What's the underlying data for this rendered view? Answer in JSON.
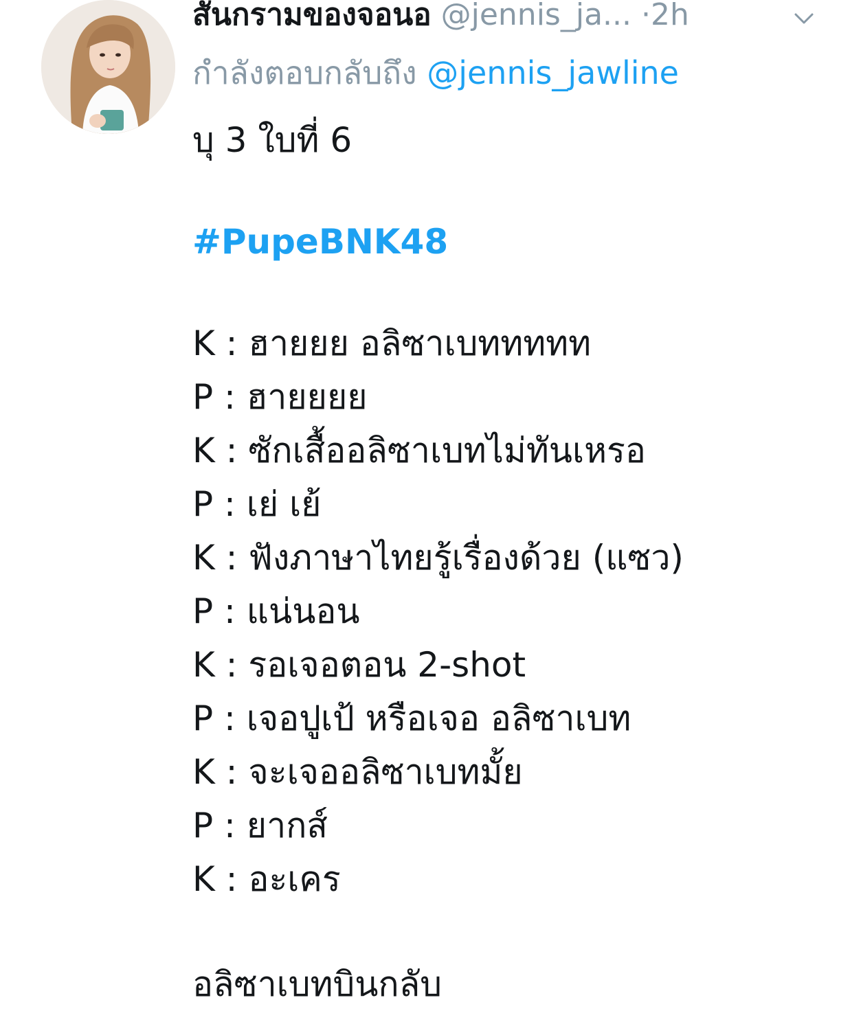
{
  "tweet": {
    "display_name": "สันกรามของจอนอ",
    "handle": "@jennis_ja...",
    "separator": "·",
    "time": "2h",
    "replying_prefix": "กำลังตอบกลับถึง",
    "replying_to": "@jennis_jawline",
    "intro": "บุ 3 ใบที่ 6",
    "hashtag": "#PupeBNK48",
    "dialogue": [
      "K : ฮายยย อลิซาเบททททท",
      "P : ฮายยยย",
      "K : ซักเสื้ออลิซาเบทไม่ทันเหรอ",
      "P : เย่ เย้",
      "K : ฟังภาษาไทยรู้เรื่องด้วย (แซว)",
      "P : แน่นอน",
      "K : รอเจอตอน 2-shot",
      "P : เจอปูเป้ หรือเจอ อลิซาเบท",
      "K : จะเจออลิซาเบทมั้ย",
      "P : ยากส์",
      "K : อะเคร"
    ],
    "closing": "อลิซาเบทบินกลับ"
  },
  "colors": {
    "text": "#14171a",
    "muted": "#8899a6",
    "accent": "#1da1f2"
  },
  "icons": {
    "avatar": "user-avatar-photo",
    "caret": "chevron-down-icon"
  }
}
